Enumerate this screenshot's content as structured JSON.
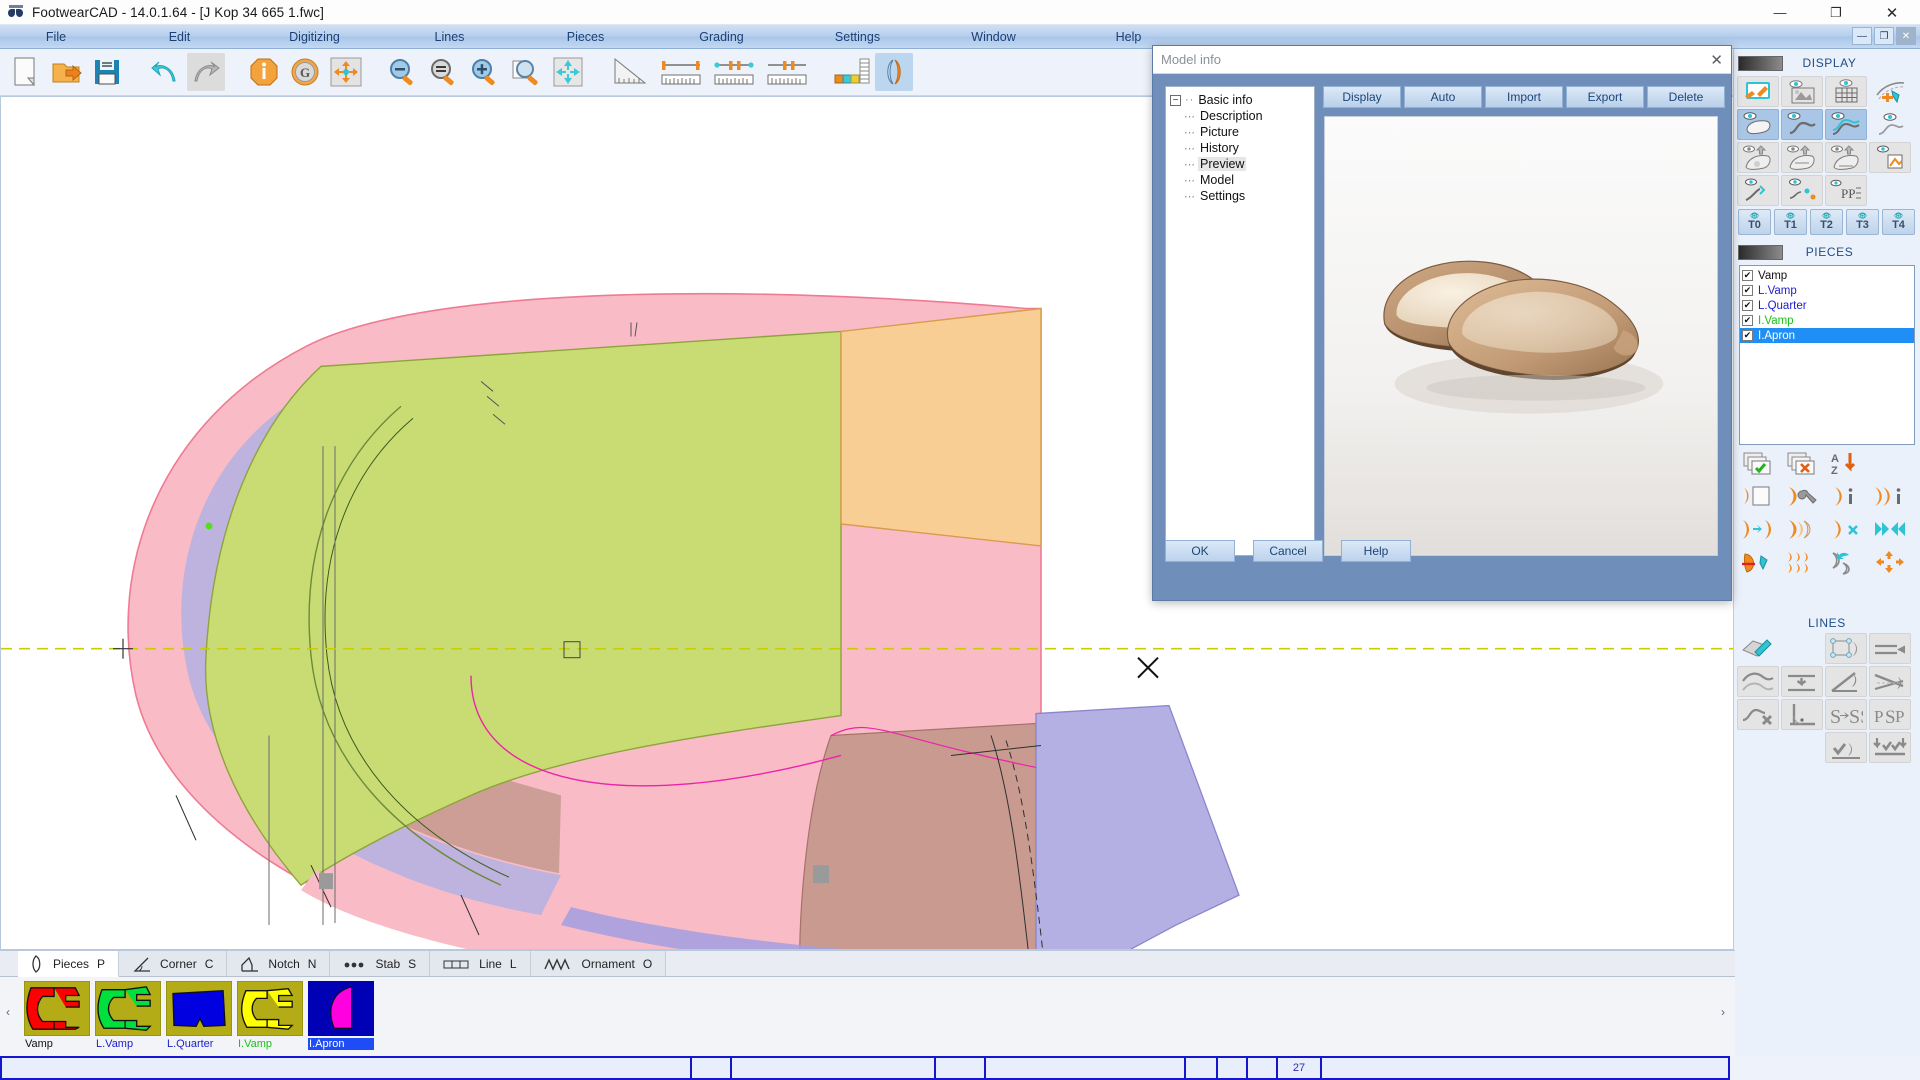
{
  "window": {
    "title": "FootwearCAD - 14.0.1.64 - [J Kop 34 665 1.fwc]",
    "app_icon": "binoculars-icon",
    "minimize": "—",
    "maximize": "❐",
    "close": "✕"
  },
  "menubar": {
    "items": [
      {
        "label": "File"
      },
      {
        "label": "Edit"
      },
      {
        "label": "Digitizing"
      },
      {
        "label": "Lines"
      },
      {
        "label": "Pieces"
      },
      {
        "label": "Grading"
      },
      {
        "label": "Settings"
      },
      {
        "label": "Window"
      },
      {
        "label": "Help"
      }
    ],
    "mdi_controls": [
      "—",
      "❐",
      "✕"
    ]
  },
  "toolbar": {
    "buttons": [
      {
        "name": "new-file-icon",
        "tip": "New"
      },
      {
        "name": "open-file-icon",
        "tip": "Open"
      },
      {
        "name": "save-icon",
        "tip": "Save"
      },
      {
        "name": "undo-icon",
        "tip": "Undo"
      },
      {
        "name": "redo-icon",
        "tip": "Redo"
      },
      {
        "name": "info-icon",
        "tip": "Model info"
      },
      {
        "name": "grading-icon",
        "tip": "Grading"
      },
      {
        "name": "move-icon",
        "tip": "Move"
      },
      {
        "name": "zoom-out-icon",
        "tip": "Zoom out"
      },
      {
        "name": "zoom-fit-icon",
        "tip": "Zoom fit"
      },
      {
        "name": "zoom-in-icon",
        "tip": "Zoom in"
      },
      {
        "name": "zoom-window-icon",
        "tip": "Zoom window"
      },
      {
        "name": "pan-icon",
        "tip": "Pan"
      },
      {
        "name": "triangle-ruler-icon",
        "tip": "Angle measure"
      },
      {
        "name": "ruler-icon",
        "tip": "Measure length"
      },
      {
        "name": "ruler-points-icon",
        "tip": "Measure points"
      },
      {
        "name": "ruler-segment-icon",
        "tip": "Measure segment"
      },
      {
        "name": "color-palette-icon",
        "tip": "Colors"
      },
      {
        "name": "mirror-pieces-icon",
        "tip": "Mirror"
      }
    ]
  },
  "display_panel": {
    "title": "DISPLAY",
    "swatch_color": "#2b2b2b",
    "icons": [
      {
        "name": "edit-model-icon",
        "active": false
      },
      {
        "name": "show-picture-icon",
        "active": false
      },
      {
        "name": "show-grid-icon",
        "active": false
      },
      {
        "name": "add-line-icon",
        "active": false
      },
      {
        "name": "show-last-icon",
        "active": true
      },
      {
        "name": "show-curve-icon",
        "active": true
      },
      {
        "name": "show-curves-icon",
        "active": true
      },
      {
        "name": "hide-curve-icon",
        "active": false
      },
      {
        "name": "show-piece-up-icon",
        "active": false
      },
      {
        "name": "show-piece-mid-icon",
        "active": false
      },
      {
        "name": "show-piece-low-icon",
        "active": false
      },
      {
        "name": "show-stack-icon",
        "active": false
      },
      {
        "name": "show-notch-icon",
        "active": false
      },
      {
        "name": "show-marks-icon",
        "active": false
      },
      {
        "name": "show-pp-icon",
        "active": false
      },
      {
        "name": "show-grade-icon",
        "active": false
      }
    ],
    "t_buttons": [
      "T0",
      "T1",
      "T2",
      "T3",
      "T4"
    ]
  },
  "pieces_panel": {
    "title": "PIECES",
    "swatch_color": "#2b2b2b",
    "items": [
      {
        "label": "Vamp",
        "checked": true,
        "color": "#111111",
        "selected": false
      },
      {
        "label": "L.Vamp",
        "checked": true,
        "color": "#2020cc",
        "selected": false
      },
      {
        "label": "L.Quarter",
        "checked": true,
        "color": "#2020cc",
        "selected": false
      },
      {
        "label": "I.Vamp",
        "checked": true,
        "color": "#14c414",
        "selected": false
      },
      {
        "label": "I.Apron",
        "checked": true,
        "color": "#111111",
        "selected": true
      }
    ],
    "check_glyph": "✔",
    "tool_icons": [
      {
        "name": "select-all-pieces-icon"
      },
      {
        "name": "deselect-all-pieces-icon"
      },
      {
        "name": "sort-az-icon"
      },
      {
        "name": "piece-copy-icon"
      },
      {
        "name": "piece-settings-icon"
      },
      {
        "name": "piece-info-icon"
      },
      {
        "name": "pieces-info-icon"
      },
      {
        "name": "piece-duplicate-icon"
      },
      {
        "name": "piece-layers-icon"
      },
      {
        "name": "piece-delete-icon"
      },
      {
        "name": "piece-mirror-icon"
      },
      {
        "name": "piece-cut-icon"
      },
      {
        "name": "piece-multiply-icon"
      },
      {
        "name": "piece-rotate-icon"
      },
      {
        "name": "piece-explode-icon"
      }
    ]
  },
  "lines_panel": {
    "title": "LINES",
    "icons": [
      {
        "name": "draw-line-icon"
      },
      {
        "name": "line-box-icon"
      },
      {
        "name": "parallel-line-icon"
      },
      {
        "name": "smooth-curve-icon"
      },
      {
        "name": "offset-line-icon"
      },
      {
        "name": "rotate-line-icon"
      },
      {
        "name": "mirror-line-icon"
      },
      {
        "name": "delete-line-icon"
      },
      {
        "name": "perpendicular-icon"
      },
      {
        "name": "multiply-curve-icon"
      },
      {
        "name": "point-to-point-icon"
      },
      {
        "name": "confirm-line-icon"
      },
      {
        "name": "apply-lines-icon"
      }
    ]
  },
  "bottom_tabs": {
    "tabs": [
      {
        "label": "Pieces",
        "key": "P",
        "icon": "piece-outline-icon",
        "active": true
      },
      {
        "label": "Corner",
        "key": "C",
        "icon": "corner-icon",
        "active": false
      },
      {
        "label": "Notch",
        "key": "N",
        "icon": "notch-icon",
        "active": false
      },
      {
        "label": "Stab",
        "key": "S",
        "icon": "stab-icon",
        "active": false
      },
      {
        "label": "Line",
        "key": "L",
        "icon": "line-icon",
        "active": false
      },
      {
        "label": "Ornament",
        "key": "O",
        "icon": "ornament-icon",
        "active": false
      }
    ],
    "scroll_left": "‹",
    "scroll_right": "›"
  },
  "thumbnails": [
    {
      "label": "Vamp",
      "shape": "c-shape",
      "fill": "#ff0000",
      "bg": "#b3ac17",
      "label_color": "#111111",
      "selected": false
    },
    {
      "label": "L.Vamp",
      "shape": "c-shape",
      "fill": "#00e03c",
      "bg": "#b3ac17",
      "label_color": "#2020cc",
      "selected": false
    },
    {
      "label": "L.Quarter",
      "shape": "quarter",
      "fill": "#0000e0",
      "bg": "#b3ac17",
      "label_color": "#2020cc",
      "selected": false
    },
    {
      "label": "I.Vamp",
      "shape": "c-shape",
      "fill": "#ffff00",
      "bg": "#b3ac17",
      "label_color": "#14c414",
      "selected": false
    },
    {
      "label": "I.Apron",
      "shape": "apron",
      "fill": "#ff00e0",
      "bg": "#0000b4",
      "label_color": "#ffffff",
      "selected": true
    }
  ],
  "dialog": {
    "title": "Model info",
    "close_glyph": "✕",
    "tree": {
      "root": {
        "label": "Basic info",
        "expanded": true,
        "collapse_glyph": "−"
      },
      "children": [
        {
          "label": "Description",
          "highlighted": false
        },
        {
          "label": "Picture",
          "highlighted": false
        },
        {
          "label": "History",
          "highlighted": false
        },
        {
          "label": "Preview",
          "highlighted": true
        },
        {
          "label": "Model",
          "highlighted": false
        },
        {
          "label": "Settings",
          "highlighted": false
        }
      ]
    },
    "tabs": [
      {
        "label": "Display"
      },
      {
        "label": "Auto"
      },
      {
        "label": "Import"
      },
      {
        "label": "Export"
      },
      {
        "label": "Delete"
      }
    ],
    "preview_image": "ballet-flats-photo",
    "buttons": [
      {
        "label": "OK"
      },
      {
        "label": "Cancel"
      },
      {
        "label": "Help"
      }
    ]
  },
  "statusbar": {
    "cells": [
      "",
      "",
      "",
      "",
      "",
      "",
      "",
      "",
      "27",
      ""
    ],
    "count_value": "27"
  },
  "canvas": {
    "description": "shoe-pattern-drawing",
    "axis_color": "#cccc00",
    "piece_colors": {
      "pink": "#f7b7c0",
      "green": "#c4d86a",
      "orange": "#f8c98a",
      "brown": "#c49a8f",
      "purple": "#b5b2e8",
      "magenta_line": "#ee22aa"
    }
  }
}
